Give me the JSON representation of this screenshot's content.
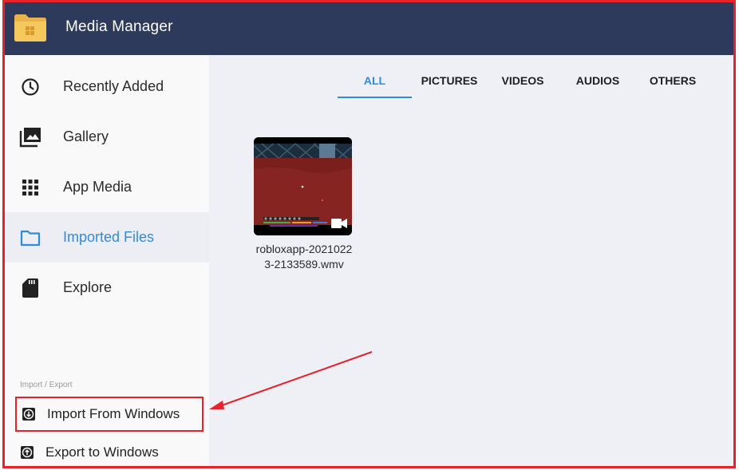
{
  "app": {
    "title": "Media Manager"
  },
  "sidebar": {
    "items": [
      {
        "label": "Recently Added",
        "icon": "clock-icon"
      },
      {
        "label": "Gallery",
        "icon": "gallery-icon"
      },
      {
        "label": "App Media",
        "icon": "grid-icon"
      },
      {
        "label": "Imported Files",
        "icon": "folder-icon",
        "active": true
      },
      {
        "label": "Explore",
        "icon": "sd-card-icon"
      }
    ],
    "section_label": "Import / Export",
    "actions": [
      {
        "label": "Import From Windows",
        "icon": "import-icon",
        "highlighted": true
      },
      {
        "label": "Export to Windows",
        "icon": "export-icon"
      }
    ]
  },
  "tabs": [
    {
      "label": "ALL",
      "active": true
    },
    {
      "label": "PICTURES"
    },
    {
      "label": "VIDEOS"
    },
    {
      "label": "AUDIOS"
    },
    {
      "label": "OTHERS"
    }
  ],
  "media": [
    {
      "name": "robloxapp-20210223-2133589.wmv",
      "type": "video"
    }
  ],
  "colors": {
    "header_bg": "#2e3a5c",
    "accent": "#2e8ce0",
    "annotation_red": "#e8222a",
    "content_bg": "#eef0f6",
    "sidebar_bg": "#f9f9f9"
  }
}
